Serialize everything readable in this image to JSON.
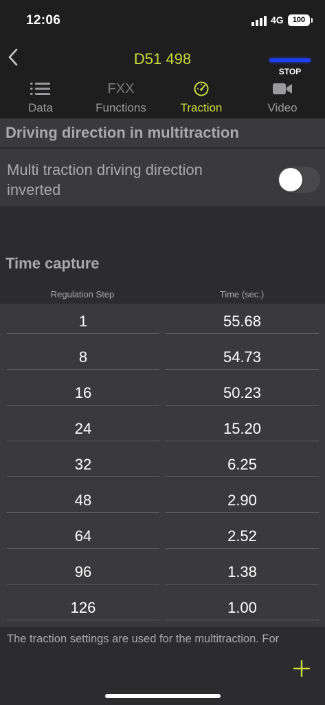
{
  "status_bar": {
    "time": "12:06",
    "network": "4G",
    "battery": "100"
  },
  "header": {
    "title": "D51 498",
    "stop_label": "STOP"
  },
  "tabs": [
    {
      "label": "Data",
      "icon": "list-icon"
    },
    {
      "label": "Functions",
      "icon_text": "FXX"
    },
    {
      "label": "Traction",
      "icon": "speedometer-icon",
      "active": true
    },
    {
      "label": "Video",
      "icon": "video-camera-icon"
    }
  ],
  "multitraction": {
    "section_title": "Driving direction in multitraction",
    "toggle_label": "Multi traction driving direction inverted",
    "toggle_on": false
  },
  "time_capture": {
    "title": "Time capture",
    "col_step": "Regulation Step",
    "col_time": "Time (sec.)",
    "rows": [
      {
        "step": "1",
        "time": "55.68"
      },
      {
        "step": "8",
        "time": "54.73"
      },
      {
        "step": "16",
        "time": "50.23"
      },
      {
        "step": "24",
        "time": "15.20"
      },
      {
        "step": "32",
        "time": "6.25"
      },
      {
        "step": "48",
        "time": "2.90"
      },
      {
        "step": "64",
        "time": "2.52"
      },
      {
        "step": "96",
        "time": "1.38"
      },
      {
        "step": "126",
        "time": "1.00"
      }
    ]
  },
  "footer": {
    "text": "The traction settings are used for the multitraction. For"
  },
  "colors": {
    "accent": "#c9dd39",
    "stop_bar": "#1f3fff",
    "background": "#2c2c2e",
    "panel": "#3a3a3c"
  }
}
